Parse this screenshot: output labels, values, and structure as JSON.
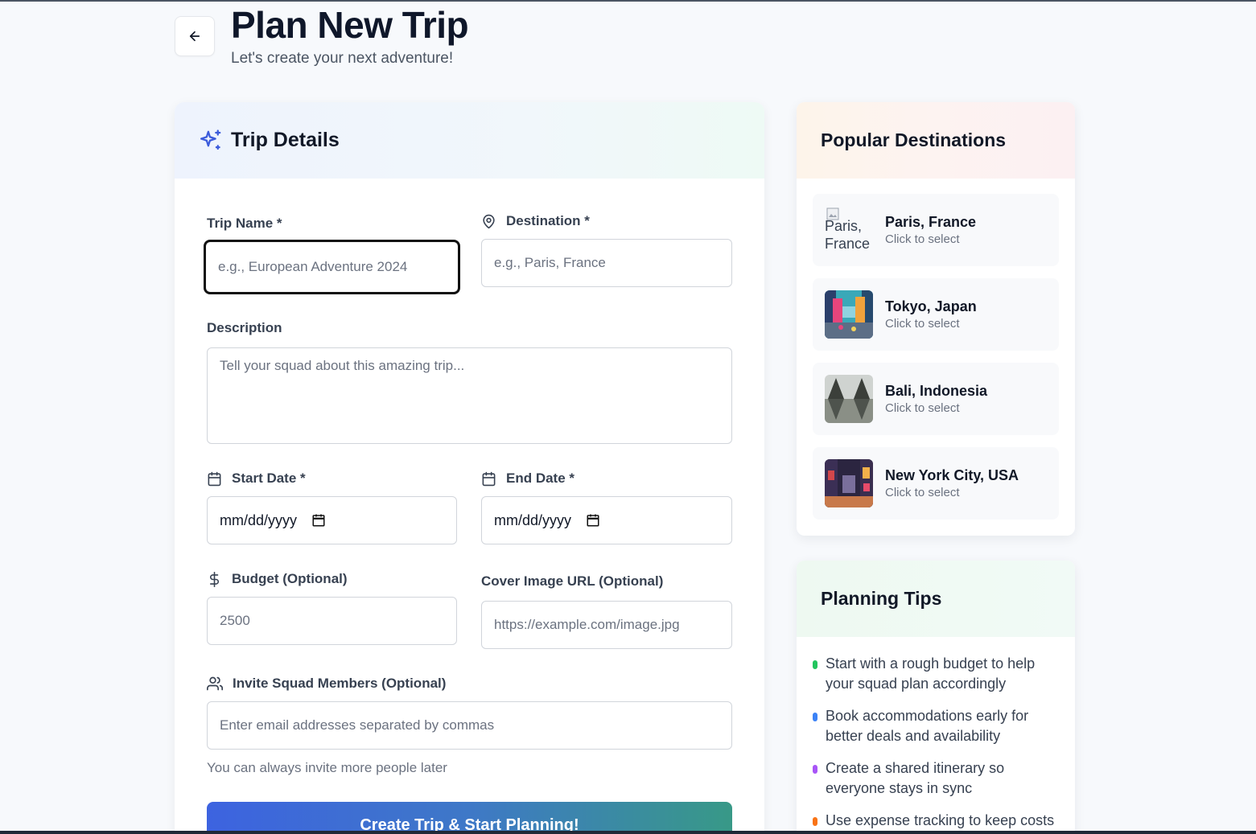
{
  "header": {
    "title": "Plan New Trip",
    "subtitle": "Let's create your next adventure!"
  },
  "form": {
    "section_title": "Trip Details",
    "trip_name": {
      "label": "Trip Name *",
      "placeholder": "e.g., European Adventure 2024",
      "value": ""
    },
    "destination": {
      "label": "Destination *",
      "placeholder": "e.g., Paris, France",
      "value": ""
    },
    "description": {
      "label": "Description",
      "placeholder": "Tell your squad about this amazing trip...",
      "value": ""
    },
    "start_date": {
      "label": "Start Date *",
      "value": "mm/dd/yyyy"
    },
    "end_date": {
      "label": "End Date *",
      "value": "mm/dd/yyyy"
    },
    "budget": {
      "label": "Budget (Optional)",
      "placeholder": "2500",
      "value": ""
    },
    "cover_image": {
      "label": "Cover Image URL (Optional)",
      "placeholder": "https://example.com/image.jpg",
      "value": ""
    },
    "invite": {
      "label": "Invite Squad Members (Optional)",
      "placeholder": "Enter email addresses separated by commas",
      "value": ""
    },
    "invite_helper": "You can always invite more people later",
    "submit_label": "Create Trip & Start Planning!"
  },
  "popular_destinations": {
    "title": "Popular Destinations",
    "items": [
      {
        "name": "Paris, France",
        "sub": "Click to select",
        "image_alt": "Paris, France",
        "image_loaded": false
      },
      {
        "name": "Tokyo, Japan",
        "sub": "Click to select",
        "image_loaded": true,
        "colors": [
          "#3aa8b8",
          "#e7457c",
          "#2b3f6b"
        ]
      },
      {
        "name": "Bali, Indonesia",
        "sub": "Click to select",
        "image_loaded": true,
        "colors": [
          "#cfd3d0",
          "#3b3f3a",
          "#8a8f86"
        ]
      },
      {
        "name": "New York City, USA",
        "sub": "Click to select",
        "image_loaded": true,
        "colors": [
          "#2b2540",
          "#d2474b",
          "#f4b04a"
        ]
      }
    ]
  },
  "planning_tips": {
    "title": "Planning Tips",
    "items": [
      {
        "text": "Start with a rough budget to help your squad plan accordingly",
        "color": "#22c55e"
      },
      {
        "text": "Book accommodations early for better deals and availability",
        "color": "#3b82f6"
      },
      {
        "text": "Create a shared itinerary so everyone stays in sync",
        "color": "#a855f7"
      },
      {
        "text": "Use expense tracking to keep costs",
        "color": "#f97316"
      }
    ]
  }
}
